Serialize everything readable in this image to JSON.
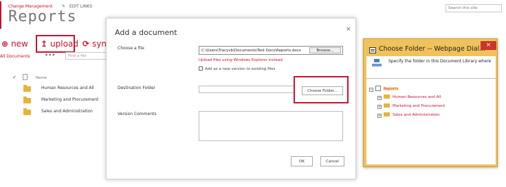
{
  "site": {
    "breadcrumb": "Change Management",
    "edit_links": "EDIT LINKS",
    "page_title": "Reports",
    "search_placeholder": "Search this site"
  },
  "toolbar": {
    "new_label": "new",
    "upload_label": "upload",
    "sync_label": "sync"
  },
  "views": {
    "all_documents": "All Documents",
    "more": "•••",
    "find_placeholder": "Find a file"
  },
  "library": {
    "name_header": "Name",
    "items": [
      "Human Resources and All",
      "Marketing and Procurement",
      "Sales and Administration"
    ]
  },
  "add_dialog": {
    "title": "Add a document",
    "close": "×",
    "choose_file_label": "Choose a file",
    "file_path": "C:\\Users\\Tracyvb\\Documents\\Test Docs\\Reports.docx",
    "browse_label": "Browse...",
    "upload_explorer_link": "Upload files using Windows Explorer instead",
    "add_version_label": "Add as a new version to existing files",
    "destination_label": "Destination Folder",
    "destination_value": "",
    "choose_folder_label": "Choose Folder...",
    "version_comments_label": "Version Comments",
    "ok_label": "OK",
    "cancel_label": "Cancel"
  },
  "folder_dialog": {
    "title": "Choose Folder -- Webpage Dial...",
    "close": "×",
    "instruction": "Specify the folder in this Document Library where",
    "root": "Reports",
    "folders": [
      "Human Resources and All",
      "Marketing and Procurement",
      "Sales and Administration"
    ]
  },
  "colors": {
    "accent": "#c8102e",
    "folder": "#e8b33b",
    "dialog_frame": "#f2c25a",
    "close_red": "#c9352b"
  }
}
